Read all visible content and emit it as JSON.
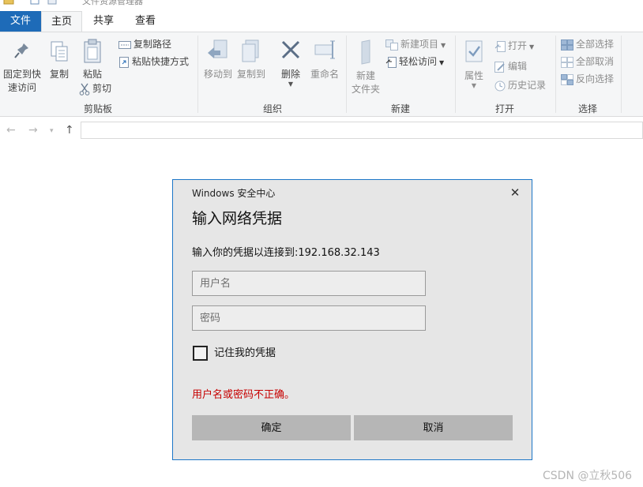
{
  "window": {
    "title": "文件资源管理器"
  },
  "tabs": [
    {
      "label": "文件"
    },
    {
      "label": "主页"
    },
    {
      "label": "共享"
    },
    {
      "label": "查看"
    }
  ],
  "ribbon": {
    "clipboard": {
      "group_label": "剪贴板",
      "pin_label_line1": "固定到快",
      "pin_label_line2": "速访问",
      "copy_label": "复制",
      "paste_label": "粘贴",
      "copy_path_label": "复制路径",
      "paste_shortcut_label": "粘贴快捷方式",
      "cut_label": "剪切"
    },
    "organize": {
      "group_label": "组织",
      "move_to_label": "移动到",
      "copy_to_label": "复制到",
      "delete_label": "删除",
      "rename_label": "重命名"
    },
    "new": {
      "group_label": "新建",
      "new_folder_line1": "新建",
      "new_folder_line2": "文件夹",
      "new_item_label": "新建项目",
      "easy_access_label": "轻松访问"
    },
    "open": {
      "group_label": "打开",
      "properties_label": "属性",
      "open_label": "打开",
      "edit_label": "编辑",
      "history_label": "历史记录"
    },
    "select": {
      "group_label": "选择",
      "select_all_label": "全部选择",
      "select_none_label": "全部取消",
      "invert_label": "反向选择"
    }
  },
  "dialog": {
    "caption": "Windows 安全中心",
    "title": "输入网络凭据",
    "prompt": "输入你的凭据以连接到:192.168.32.143",
    "username_placeholder": "用户名",
    "password_placeholder": "密码",
    "remember_label": "记住我的凭据",
    "remember_checked": false,
    "error_message": "用户名或密码不正确。",
    "ok_label": "确定",
    "cancel_label": "取消",
    "accent_color": "#1c76c7",
    "error_color": "#c70000"
  },
  "watermark": "CSDN @立秋506"
}
